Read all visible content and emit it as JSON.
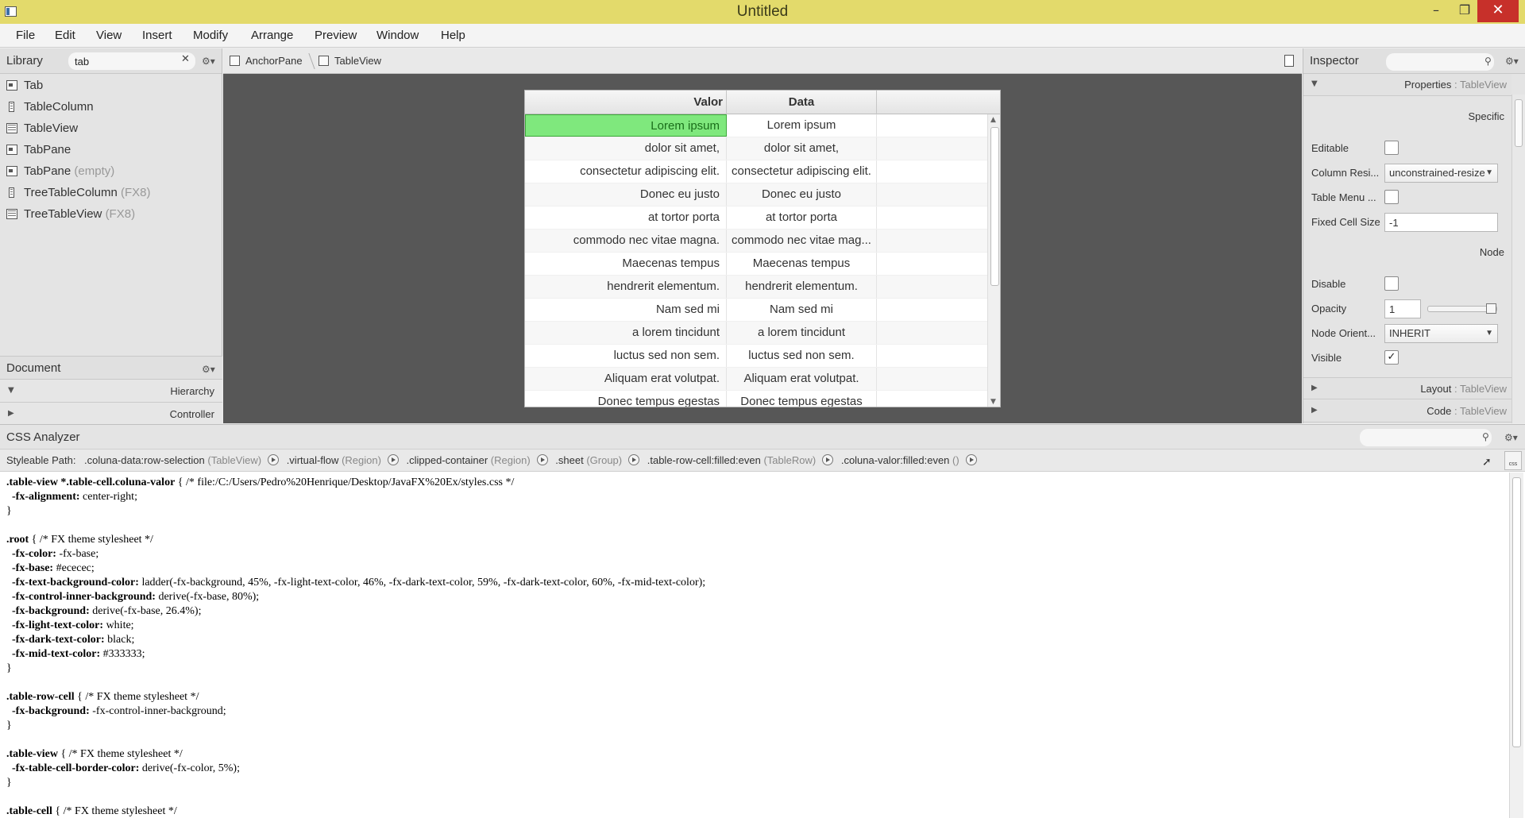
{
  "window": {
    "title": "Untitled"
  },
  "menu": [
    "File",
    "Edit",
    "View",
    "Insert",
    "Modify",
    "Arrange",
    "Preview",
    "Window",
    "Help"
  ],
  "library": {
    "title": "Library",
    "search_value": "tab",
    "items": [
      {
        "label": "Tab",
        "suffix": "",
        "icon": "tab-icon"
      },
      {
        "label": "TableColumn",
        "suffix": "",
        "icon": "table-column-icon"
      },
      {
        "label": "TableView",
        "suffix": "",
        "icon": "table-view-icon"
      },
      {
        "label": "TabPane",
        "suffix": "",
        "icon": "tab-pane-icon"
      },
      {
        "label": "TabPane",
        "suffix": "(empty)",
        "icon": "tab-pane-icon"
      },
      {
        "label": "TreeTableColumn",
        "suffix": "(FX8)",
        "icon": "tree-table-column-icon"
      },
      {
        "label": "TreeTableView",
        "suffix": "(FX8)",
        "icon": "tree-table-view-icon"
      }
    ]
  },
  "document": {
    "title": "Document",
    "sections": [
      "Hierarchy",
      "Controller"
    ]
  },
  "breadcrumb": [
    "AnchorPane",
    "TableView"
  ],
  "table": {
    "columns": [
      "Valor",
      "Data"
    ],
    "rows": [
      [
        "Lorem ipsum",
        "Lorem ipsum"
      ],
      [
        "dolor sit amet,",
        "dolor sit amet,"
      ],
      [
        "consectetur adipiscing elit.",
        "consectetur adipiscing elit."
      ],
      [
        "Donec eu justo",
        "Donec eu justo"
      ],
      [
        "at tortor porta",
        "at tortor porta"
      ],
      [
        "commodo nec vitae magna.",
        "commodo nec vitae mag..."
      ],
      [
        "Maecenas tempus",
        "Maecenas tempus"
      ],
      [
        "hendrerit elementum.",
        "hendrerit elementum."
      ],
      [
        "Nam sed mi",
        "Nam sed mi"
      ],
      [
        "a lorem tincidunt",
        "a lorem tincidunt"
      ],
      [
        "luctus sed non sem.",
        "luctus sed non sem."
      ],
      [
        "Aliquam erat volutpat.",
        "Aliquam erat volutpat."
      ],
      [
        "Donec tempus egestas",
        "Donec tempus egestas"
      ]
    ],
    "highlight_color": "#7fe87d"
  },
  "inspector": {
    "title": "Inspector",
    "properties_label": "Properties",
    "layout_label": "Layout",
    "code_label": "Code",
    "target": ": TableView",
    "groups": {
      "specific": "Specific",
      "node": "Node"
    },
    "props": {
      "editable": "Editable",
      "column_resize": "Column Resi...",
      "column_resize_value": "unconstrained-resize",
      "table_menu": "Table Menu ...",
      "fixed_cell_size": "Fixed Cell Size",
      "fixed_cell_size_value": "-1",
      "disable": "Disable",
      "opacity": "Opacity",
      "opacity_value": "1",
      "node_orientation": "Node Orient...",
      "node_orientation_value": "INHERIT",
      "visible": "Visible",
      "visible_mark": "✓"
    }
  },
  "analyzer": {
    "title": "CSS Analyzer",
    "path_label": "Styleable Path:",
    "path": [
      {
        "sel": ".coluna-data:row-selection",
        "type": "(TableView)"
      },
      {
        "sel": ".virtual-flow",
        "type": "(Region)"
      },
      {
        "sel": ".clipped-container",
        "type": "(Region)"
      },
      {
        "sel": ".sheet",
        "type": "(Group)"
      },
      {
        "sel": ".table-row-cell:filled:even",
        "type": "(TableRow)"
      },
      {
        "sel": ".coluna-valor:filled:even",
        "type": "()"
      }
    ],
    "css_button": "css",
    "code_lines": [
      {
        "b": ".table-view *.table-cell.coluna-valor",
        "t": " { /* file:/C:/Users/Pedro%20Henrique/Desktop/JavaFX%20Ex/styles.css */"
      },
      {
        "b": "  -fx-alignment:",
        "t": " center-right;"
      },
      {
        "b": "",
        "t": "}"
      },
      {
        "b": "",
        "t": ""
      },
      {
        "b": ".root",
        "t": " { /* FX theme stylesheet */"
      },
      {
        "b": "  -fx-color:",
        "t": " -fx-base;"
      },
      {
        "b": "  -fx-base:",
        "t": " #ececec;"
      },
      {
        "b": "  -fx-text-background-color:",
        "t": " ladder(-fx-background, 45%, -fx-light-text-color, 46%, -fx-dark-text-color, 59%, -fx-dark-text-color, 60%, -fx-mid-text-color);"
      },
      {
        "b": "  -fx-control-inner-background:",
        "t": " derive(-fx-base, 80%);"
      },
      {
        "b": "  -fx-background:",
        "t": " derive(-fx-base, 26.4%);"
      },
      {
        "b": "  -fx-light-text-color:",
        "t": " white;"
      },
      {
        "b": "  -fx-dark-text-color:",
        "t": " black;"
      },
      {
        "b": "  -fx-mid-text-color:",
        "t": " #333333;"
      },
      {
        "b": "",
        "t": "}"
      },
      {
        "b": "",
        "t": ""
      },
      {
        "b": ".table-row-cell",
        "t": " { /* FX theme stylesheet */"
      },
      {
        "b": "  -fx-background:",
        "t": " -fx-control-inner-background;"
      },
      {
        "b": "",
        "t": "}"
      },
      {
        "b": "",
        "t": ""
      },
      {
        "b": ".table-view",
        "t": " { /* FX theme stylesheet */"
      },
      {
        "b": "  -fx-table-cell-border-color:",
        "t": " derive(-fx-color, 5%);"
      },
      {
        "b": "",
        "t": "}"
      },
      {
        "b": "",
        "t": ""
      },
      {
        "b": ".table-cell",
        "t": " { /* FX theme stylesheet */"
      }
    ]
  }
}
